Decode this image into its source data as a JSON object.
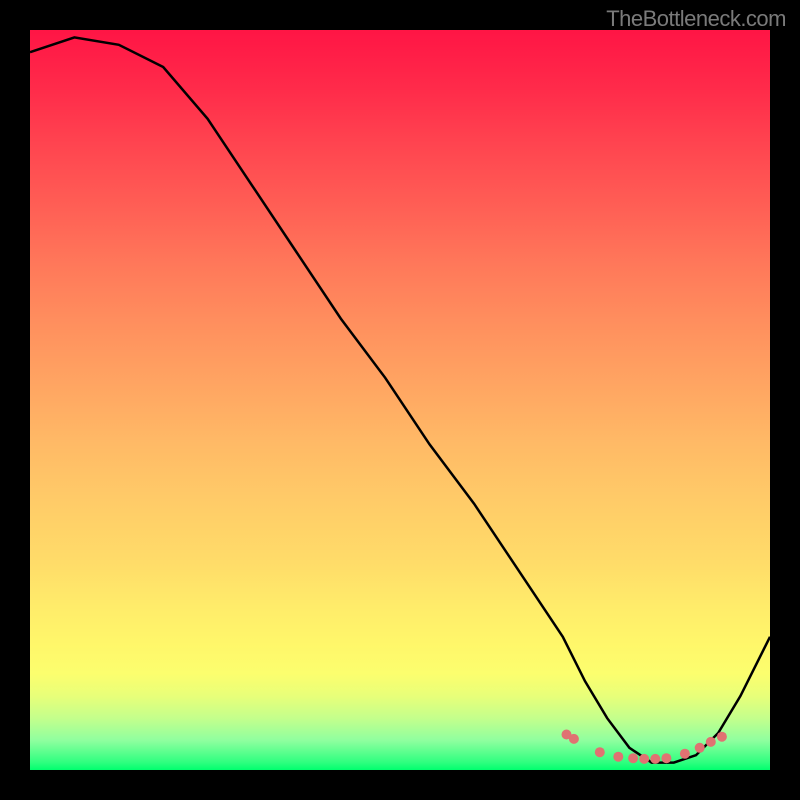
{
  "attribution": "TheBottleneck.com",
  "chart_data": {
    "type": "line",
    "title": "",
    "xlabel": "",
    "ylabel": "",
    "xlim": [
      0,
      100
    ],
    "ylim": [
      0,
      100
    ],
    "grid": false,
    "series": [
      {
        "name": "bottleneck-curve",
        "x": [
          0,
          6,
          12,
          18,
          24,
          30,
          36,
          42,
          48,
          54,
          60,
          66,
          72,
          75,
          78,
          81,
          84,
          87,
          90,
          93,
          96,
          100
        ],
        "values": [
          97,
          99,
          98,
          95,
          88,
          79,
          70,
          61,
          53,
          44,
          36,
          27,
          18,
          12,
          7,
          3,
          1,
          1,
          2,
          5,
          10,
          18
        ]
      }
    ],
    "markers": {
      "name": "highlighted-points",
      "x": [
        72.5,
        73.5,
        77.0,
        79.5,
        81.5,
        83.0,
        84.5,
        86.0,
        88.5,
        90.5,
        92.0,
        93.5
      ],
      "values": [
        4.8,
        4.2,
        2.4,
        1.8,
        1.6,
        1.5,
        1.5,
        1.6,
        2.2,
        3.0,
        3.8,
        4.5
      ]
    },
    "background": {
      "type": "vertical-gradient",
      "stops": [
        {
          "pos": 0.0,
          "color": "#ff1545"
        },
        {
          "pos": 0.5,
          "color": "#ffba66"
        },
        {
          "pos": 0.85,
          "color": "#fff76a"
        },
        {
          "pos": 1.0,
          "color": "#00ff6e"
        }
      ]
    }
  }
}
